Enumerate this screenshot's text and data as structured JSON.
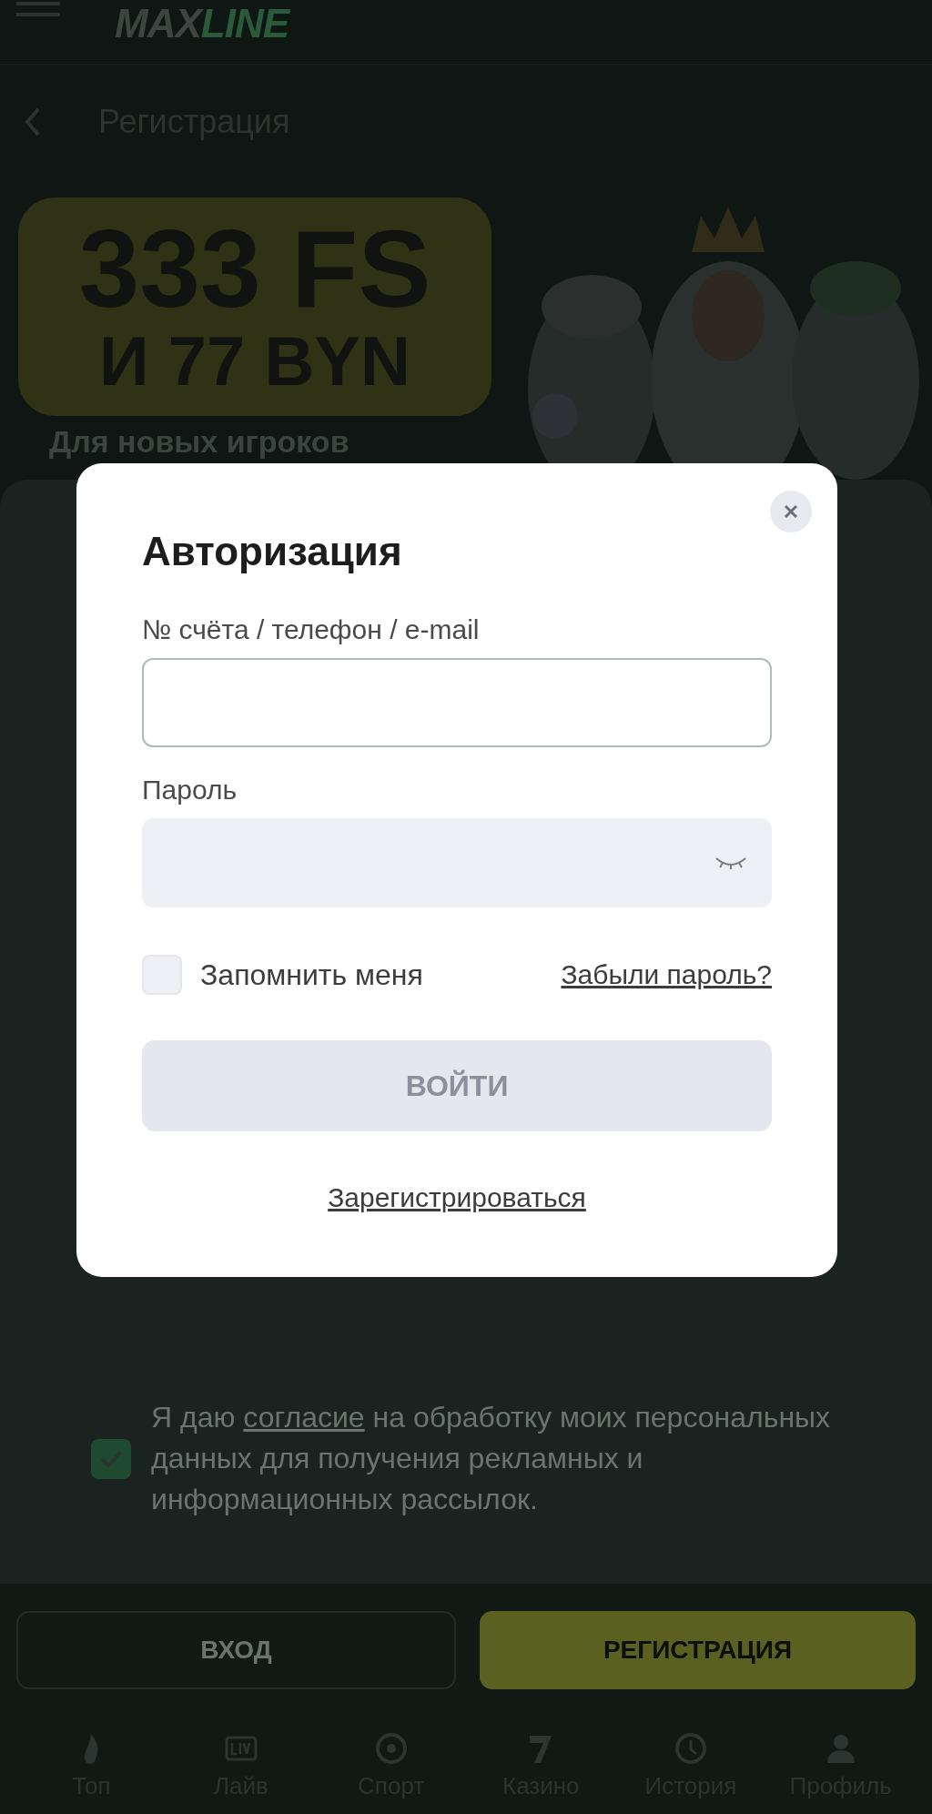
{
  "header": {
    "logo": {
      "part_1": "MAX",
      "part_2": "LINE"
    }
  },
  "page": {
    "title": "Регистрация"
  },
  "banner": {
    "line_1": "333 FS",
    "line_2": "И 77 BYN",
    "subtitle": "Для новых игроков"
  },
  "consent": {
    "checked": true,
    "before": "Я даю",
    "link": "согласие",
    "after": "на обработку моих персональных данных для получения рекламных и информационных рассылок."
  },
  "actions": [
    {
      "label": "ВХОД",
      "kind": "outline"
    },
    {
      "label": "РЕГИСТРАЦИЯ",
      "kind": "primary"
    }
  ],
  "nav": [
    {
      "label": "Топ"
    },
    {
      "label": "Лайв"
    },
    {
      "label": "Спорт"
    },
    {
      "label": "Казино"
    },
    {
      "label": "История"
    },
    {
      "label": "Профиль"
    }
  ],
  "modal": {
    "title": "Авторизация",
    "fields": [
      {
        "label": "№ счёта / телефон / e-mail",
        "kind": "text",
        "focused": true
      },
      {
        "label": "Пароль",
        "kind": "password",
        "focused": false
      }
    ],
    "remember": {
      "label": "Запомнить меня",
      "checked": false
    },
    "forgot": "Забыли пароль?",
    "submit": {
      "label": "ВОЙТИ",
      "disabled": true
    },
    "register": "Зарегистрироваться"
  }
}
